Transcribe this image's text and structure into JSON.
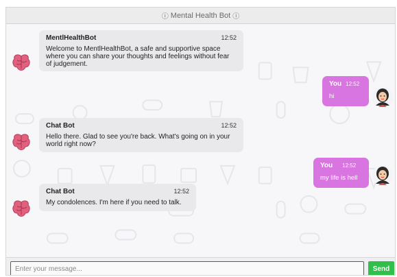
{
  "header": {
    "title": "Mental Health Bot",
    "icon": "info-circle-icon"
  },
  "messages": [
    {
      "sender": "MentlHealthBot",
      "time": "12:52",
      "text": "Welcome to MentlHealthBot, a safe and supportive space where you can share your thoughts and feelings without fear of judgement.",
      "avatar": "brain-icon"
    },
    {
      "sender": "You",
      "time": "12:52",
      "text": "hi",
      "avatar": "user-avatar-icon"
    },
    {
      "sender": "Chat Bot",
      "time": "12:52",
      "text": "Hello there. Glad to see you're back. What's going on in your world right now?",
      "avatar": "brain-icon"
    },
    {
      "sender": "You",
      "time": "12:52",
      "text": "my life is hell",
      "avatar": "user-avatar-icon"
    },
    {
      "sender": "Chat Bot",
      "time": "12:52",
      "text": "My condolences. I'm here if you need to talk.",
      "avatar": "brain-icon"
    }
  ],
  "input": {
    "placeholder": "Enter your message...",
    "value": ""
  },
  "send_button": {
    "label": "Send"
  },
  "colors": {
    "user_bubble": "#d975e0",
    "bot_bubble": "#e9e9ec",
    "send_button": "#2fbf4a",
    "brain": "#e0607e"
  }
}
